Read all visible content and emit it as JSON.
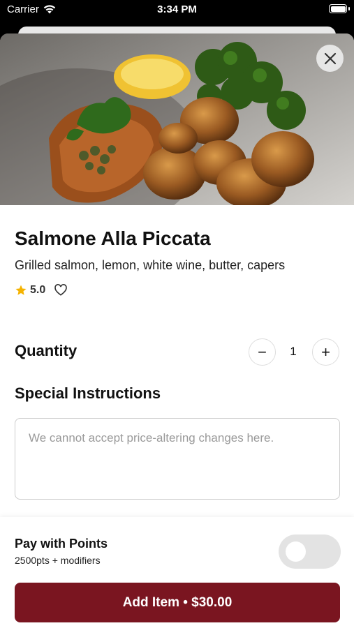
{
  "status_bar": {
    "carrier": "Carrier",
    "time": "3:34 PM"
  },
  "item": {
    "name": "Salmone Alla Piccata",
    "description": "Grilled salmon, lemon, white wine, butter, capers",
    "rating": "5.0"
  },
  "quantity": {
    "label": "Quantity",
    "value": "1",
    "minus": "−",
    "plus": "+"
  },
  "instructions": {
    "label": "Special Instructions",
    "placeholder": "We cannot accept price-altering changes here."
  },
  "points": {
    "title": "Pay with Points",
    "subtitle": "2500pts + modifiers",
    "enabled": false
  },
  "add_button": {
    "label": "Add Item • $30.00"
  },
  "colors": {
    "accent": "#7a1520",
    "star": "#f5b301"
  }
}
